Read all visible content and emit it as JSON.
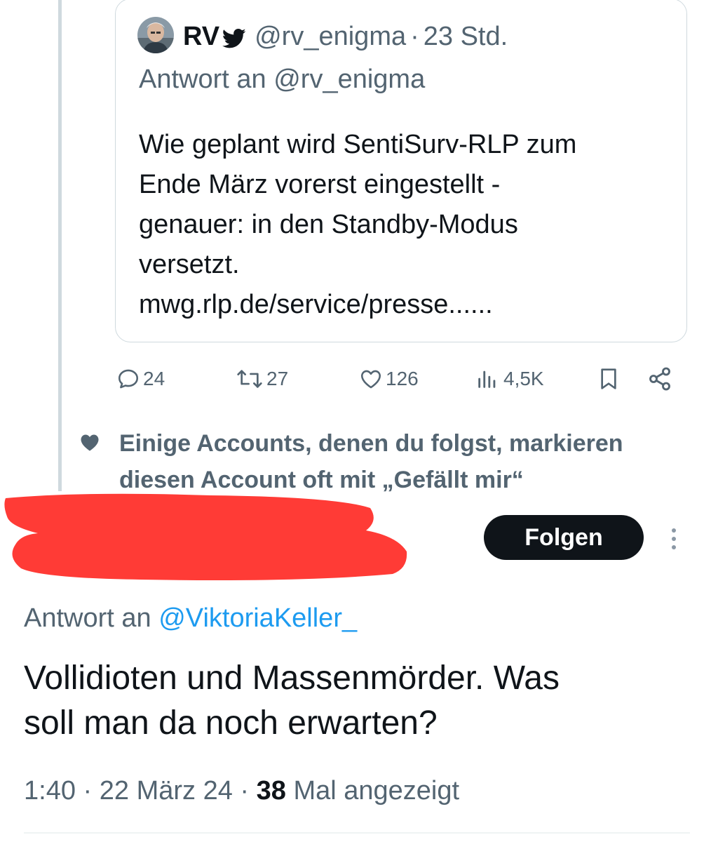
{
  "quoted_tweet": {
    "author_name": "RV",
    "handle": "@rv_enigma",
    "separator": "·",
    "time": "23 Std.",
    "reply_prefix": "Antwort an",
    "reply_to": "@rv_enigma",
    "text_lines": [
      "Wie geplant wird SentiSurv-RLP zum",
      "Ende März vorerst eingestellt -",
      "genauer: in den Standby-Modus",
      "versetzt.",
      "mwg.rlp.de/service/presse......"
    ],
    "avatar_icon": "avatar-photo",
    "verified_icon": "twitter-bird-icon"
  },
  "actions": {
    "replies": "24",
    "retweets": "27",
    "likes": "126",
    "views": "4,5K",
    "icons": [
      "reply-icon",
      "retweet-icon",
      "like-icon",
      "views-icon",
      "bookmark-icon",
      "share-icon"
    ]
  },
  "social_context": {
    "line1": "Einige Accounts, denen du folgst, markieren",
    "line2": "diesen Account oft mit „Gefällt mir“"
  },
  "follow_button": "Folgen",
  "main_tweet": {
    "reply_prefix": "Antwort an",
    "reply_to": "@ViktoriaKeller_",
    "text_lines": [
      "Vollidioten und Massenmörder. Was",
      "soll man da noch erwarten?"
    ],
    "time": "1:40",
    "separator": "·",
    "date": "22 März 24",
    "view_count": "38",
    "view_label": "Mal angezeigt"
  },
  "colors": {
    "text": "#0f1419",
    "muted": "#536471",
    "link": "#1d9bf0",
    "redaction": "#ff3b36",
    "border": "#cfd9de"
  }
}
